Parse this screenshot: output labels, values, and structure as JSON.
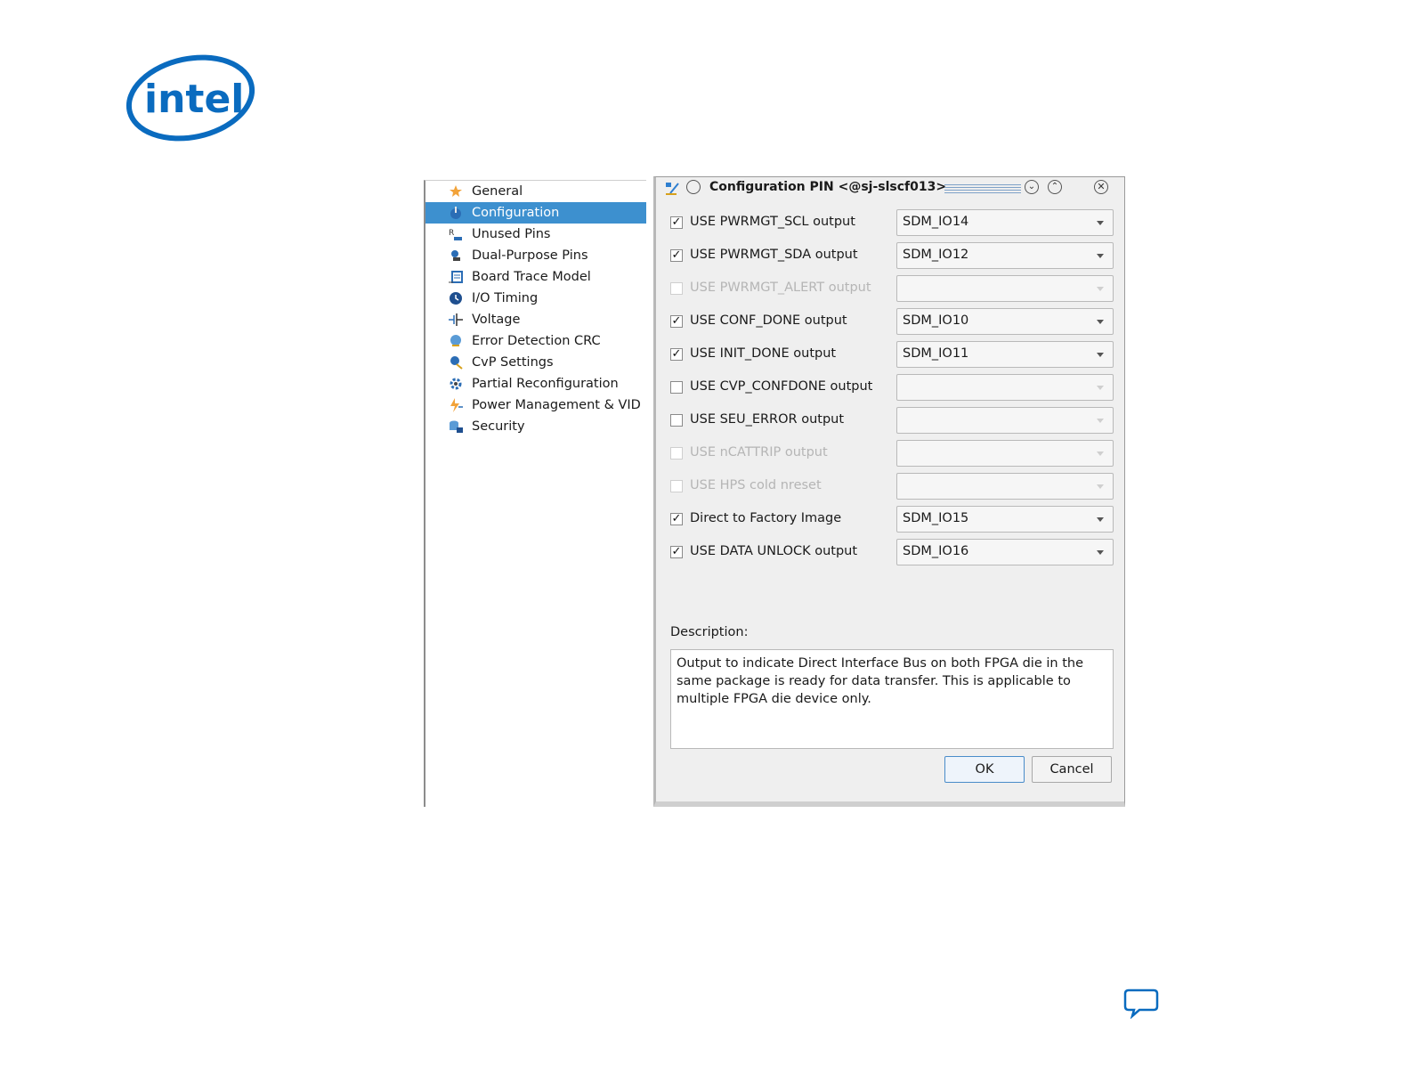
{
  "logo": {
    "text": "intel",
    "brand_color": "#0a6bbf"
  },
  "categories": {
    "items": [
      {
        "label": "General",
        "icon": "general-star-icon",
        "selected": false
      },
      {
        "label": "Configuration",
        "icon": "configuration-icon",
        "selected": true
      },
      {
        "label": "Unused Pins",
        "icon": "unused-pins-icon",
        "selected": false
      },
      {
        "label": "Dual-Purpose Pins",
        "icon": "dual-purpose-pins-icon",
        "selected": false
      },
      {
        "label": "Board Trace Model",
        "icon": "board-trace-icon",
        "selected": false
      },
      {
        "label": "I/O Timing",
        "icon": "clock-icon",
        "selected": false
      },
      {
        "label": "Voltage",
        "icon": "voltage-icon",
        "selected": false
      },
      {
        "label": "Error Detection CRC",
        "icon": "crc-icon",
        "selected": false
      },
      {
        "label": "CvP Settings",
        "icon": "cvp-icon",
        "selected": false
      },
      {
        "label": "Partial Reconfiguration",
        "icon": "partial-reconfig-icon",
        "selected": false
      },
      {
        "label": "Power Management & VID",
        "icon": "power-icon",
        "selected": false
      },
      {
        "label": "Security",
        "icon": "security-icon",
        "selected": false
      }
    ],
    "selected_color": "#3d90cf"
  },
  "dialog": {
    "title": "Configuration PIN <@sj-slscf013>",
    "options": [
      {
        "label": "USE PWRMGT_SCL output",
        "checked": true,
        "enabled": true,
        "value": "SDM_IO14"
      },
      {
        "label": "USE PWRMGT_SDA output",
        "checked": true,
        "enabled": true,
        "value": "SDM_IO12"
      },
      {
        "label": "USE PWRMGT_ALERT output",
        "checked": false,
        "enabled": false,
        "value": ""
      },
      {
        "label": "USE CONF_DONE output",
        "checked": true,
        "enabled": true,
        "value": "SDM_IO10"
      },
      {
        "label": "USE INIT_DONE output",
        "checked": true,
        "enabled": true,
        "value": "SDM_IO11"
      },
      {
        "label": "USE CVP_CONFDONE output",
        "checked": false,
        "enabled": true,
        "value": ""
      },
      {
        "label": "USE SEU_ERROR output",
        "checked": false,
        "enabled": true,
        "value": ""
      },
      {
        "label": "USE nCATTRIP output",
        "checked": false,
        "enabled": false,
        "value": ""
      },
      {
        "label": "USE HPS cold nreset",
        "checked": false,
        "enabled": false,
        "value": ""
      },
      {
        "label": "Direct to Factory Image",
        "checked": true,
        "enabled": true,
        "value": "SDM_IO15"
      },
      {
        "label": "USE DATA UNLOCK output",
        "checked": true,
        "enabled": true,
        "value": "SDM_IO16"
      }
    ],
    "description_label": "Description:",
    "description_text": "Output to indicate Direct Interface Bus on both FPGA die in the same package is ready for data transfer. This is applicable to multiple FPGA die device only.",
    "ok_label": "OK",
    "cancel_label": "Cancel"
  }
}
